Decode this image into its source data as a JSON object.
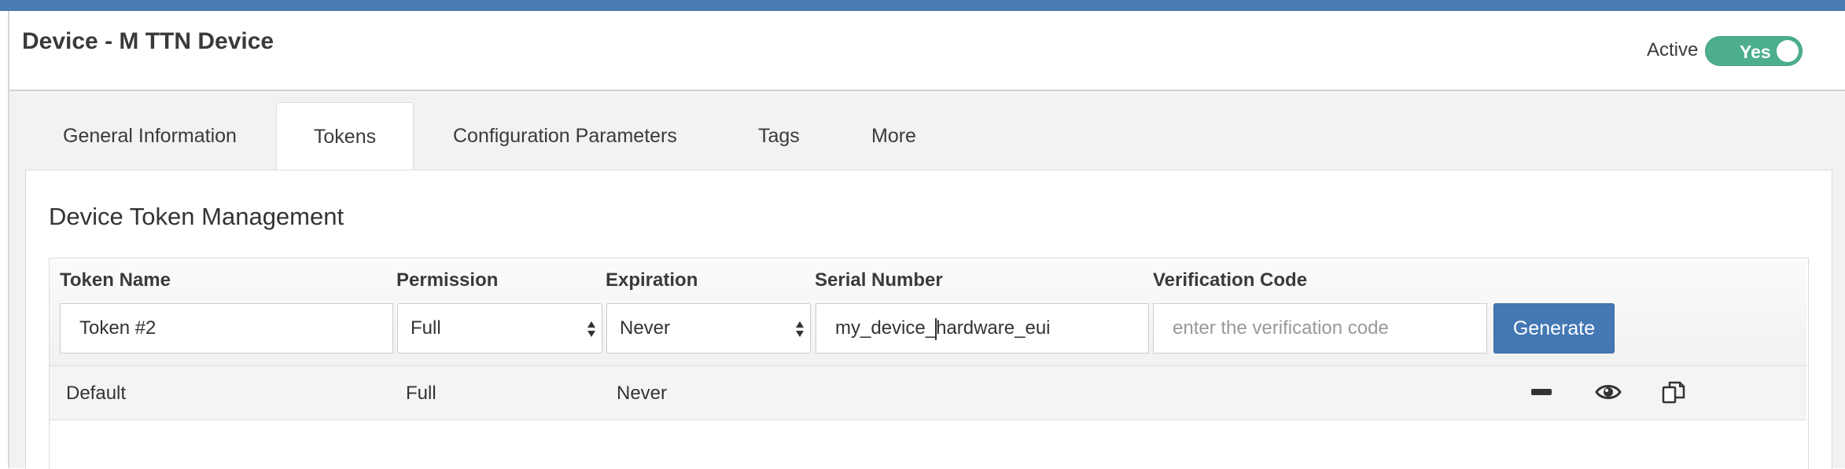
{
  "header": {
    "title": "Device - M TTN Device",
    "active_label": "Active",
    "active_toggle": "Yes"
  },
  "tabs": [
    {
      "label": "General Information"
    },
    {
      "label": "Tokens"
    },
    {
      "label": "Configuration Parameters"
    },
    {
      "label": "Tags"
    },
    {
      "label": "More"
    }
  ],
  "panel": {
    "title": "Device Token Management"
  },
  "table": {
    "headers": {
      "token_name": "Token Name",
      "permission": "Permission",
      "expiration": "Expiration",
      "serial_number": "Serial Number",
      "verification_code": "Verification Code"
    },
    "form": {
      "token_name": "Token #2",
      "permission": "Full",
      "expiration": "Never",
      "serial_before_cursor": "my_device_",
      "serial_after_cursor": "hardware_eui",
      "verification_placeholder": "enter the verification code",
      "generate_label": "Generate"
    },
    "rows": [
      {
        "name": "Default",
        "permission": "Full",
        "expiration": "Never",
        "actions": [
          "minus-icon",
          "eye-icon",
          "copy-icon"
        ]
      }
    ]
  },
  "colors": {
    "topbar": "#4a7db5",
    "toggle": "#4cae8c",
    "primary_button": "#4378b4"
  }
}
